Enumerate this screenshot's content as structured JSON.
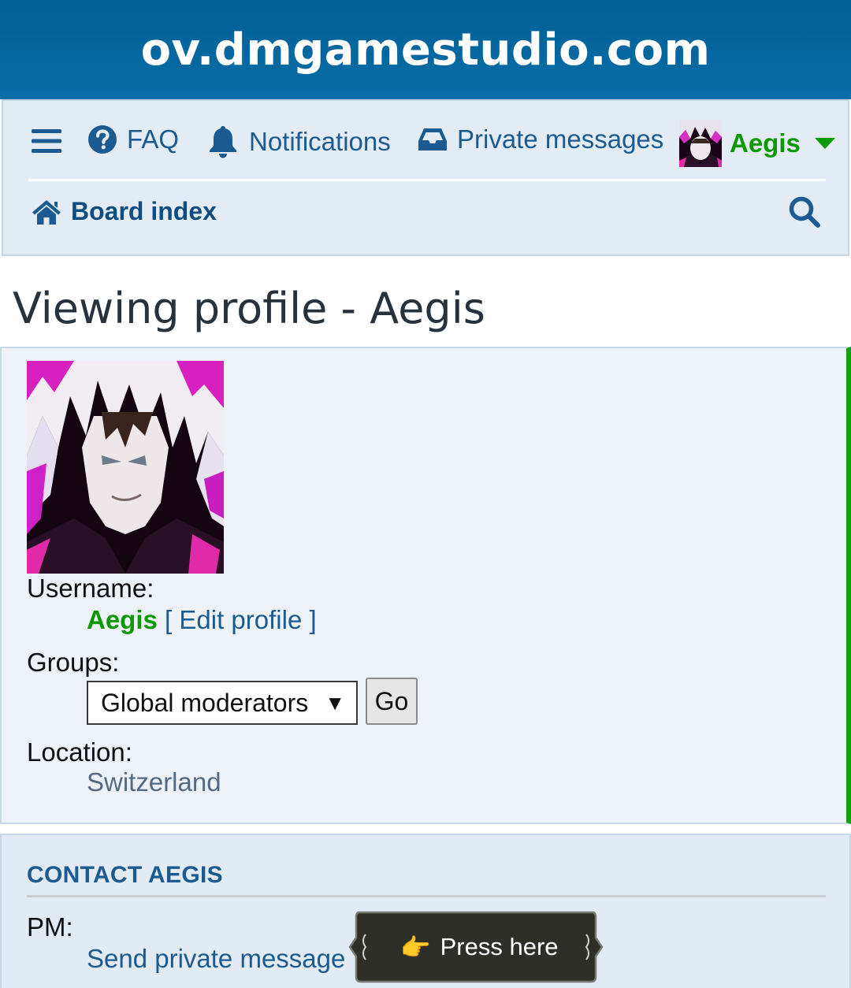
{
  "site": {
    "title": "ov.dmgamestudio.com"
  },
  "nav": {
    "menu_icon": "hamburger-icon",
    "faq": {
      "icon": "question-circle-icon",
      "label": "FAQ"
    },
    "notifications": {
      "icon": "bell-icon",
      "label": "Notifications"
    },
    "private_messages": {
      "icon": "inbox-icon",
      "label": "Private messages"
    },
    "user": {
      "name": "Aegis",
      "icon": "caret-down-icon",
      "name_color": "#0a9a00"
    },
    "board_index": {
      "icon": "home-icon",
      "label": "Board index"
    },
    "search_icon": "search-icon"
  },
  "page": {
    "title": "Viewing profile - Aegis"
  },
  "profile": {
    "username_label": "Username:",
    "username": "Aegis",
    "bracket_open": "[",
    "edit_profile": "Edit profile",
    "bracket_close": "]",
    "groups_label": "Groups:",
    "groups_selected": "Global moderators",
    "groups_arrow": "▼",
    "go_button": "Go",
    "location_label": "Location:",
    "location": "Switzerland"
  },
  "contact": {
    "heading": "CONTACT AEGIS",
    "pm_label": "PM:",
    "pm_link": "Send private message"
  },
  "overlay": {
    "hand": "👉",
    "label": "Press here"
  },
  "colors": {
    "header_bg": "#005f95",
    "nav_bg": "#e3ecf4",
    "link": "#1b5b92",
    "username_green": "#0a9a00",
    "panel_accent": "#11a010"
  }
}
